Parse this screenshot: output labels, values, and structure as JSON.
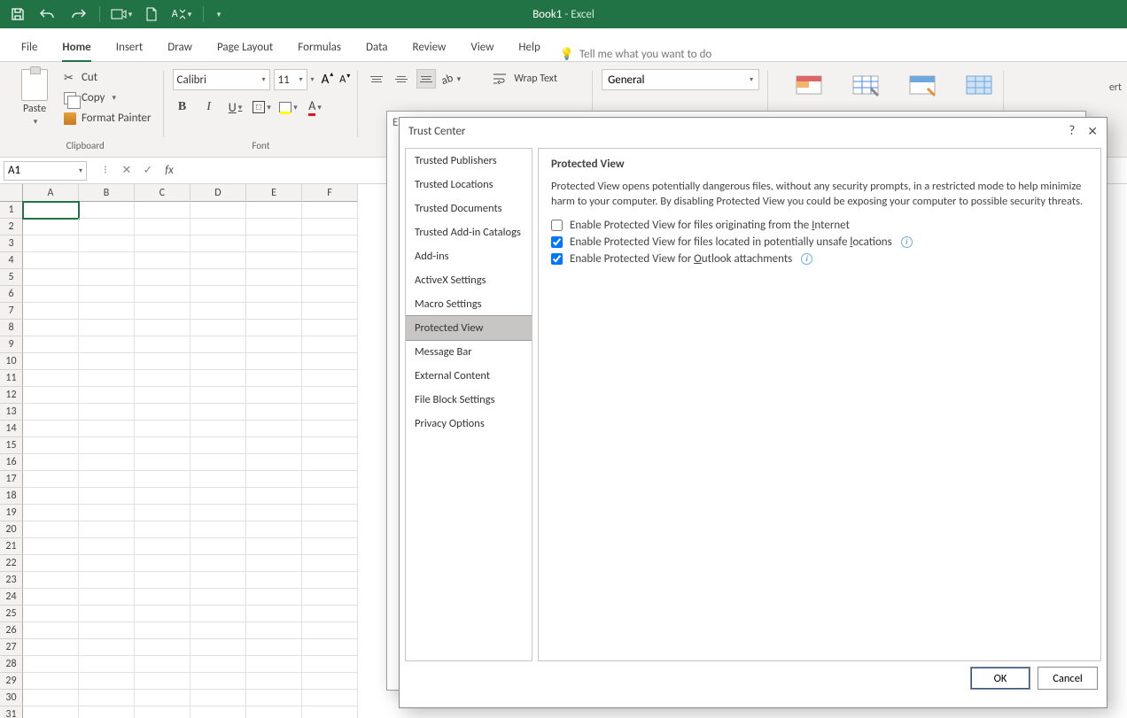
{
  "title": {
    "book": "Book1",
    "sep": " - ",
    "app": "Excel"
  },
  "tabs": [
    "File",
    "Home",
    "Insert",
    "Draw",
    "Page Layout",
    "Formulas",
    "Data",
    "Review",
    "View",
    "Help"
  ],
  "tellme": "Tell me what you want to do",
  "clipboard": {
    "paste": "Paste",
    "cut": "Cut",
    "copy": "Copy",
    "format_painter": "Format Painter",
    "group_label": "Clipboard"
  },
  "font": {
    "name": "Calibri",
    "size": "11",
    "group_label": "Font"
  },
  "alignment": {
    "wrap": "Wrap Text"
  },
  "number": {
    "format": "General"
  },
  "insert_label": "ert",
  "name_box": "A1",
  "columns": [
    "A",
    "B",
    "C",
    "D",
    "E",
    "F"
  ],
  "rows_count": 31,
  "excel_options_title": "Excel Options",
  "trust_center": {
    "title": "Trust Center",
    "nav": [
      "Trusted Publishers",
      "Trusted Locations",
      "Trusted Documents",
      "Trusted Add-in Catalogs",
      "Add-ins",
      "ActiveX Settings",
      "Macro Settings",
      "Protected View",
      "Message Bar",
      "External Content",
      "File Block Settings",
      "Privacy Options"
    ],
    "selected": "Protected View",
    "section_title": "Protected View",
    "description": "Protected View opens potentially dangerous files, without any security prompts, in a restricted mode to help minimize harm to your computer. By disabling Protected View you could be exposing your computer to possible security threats.",
    "checks": [
      {
        "label_pre": "Enable Protected View for files originating from the ",
        "u": "I",
        "label_post": "nternet",
        "checked": false,
        "info": false
      },
      {
        "label_pre": "Enable Protected View for files located in potentially unsafe ",
        "u": "l",
        "label_post": "ocations",
        "checked": true,
        "info": true
      },
      {
        "label_pre": "Enable Protected View for ",
        "u": "O",
        "label_post": "utlook attachments",
        "checked": true,
        "info": true
      }
    ],
    "ok": "OK",
    "cancel": "Cancel"
  }
}
